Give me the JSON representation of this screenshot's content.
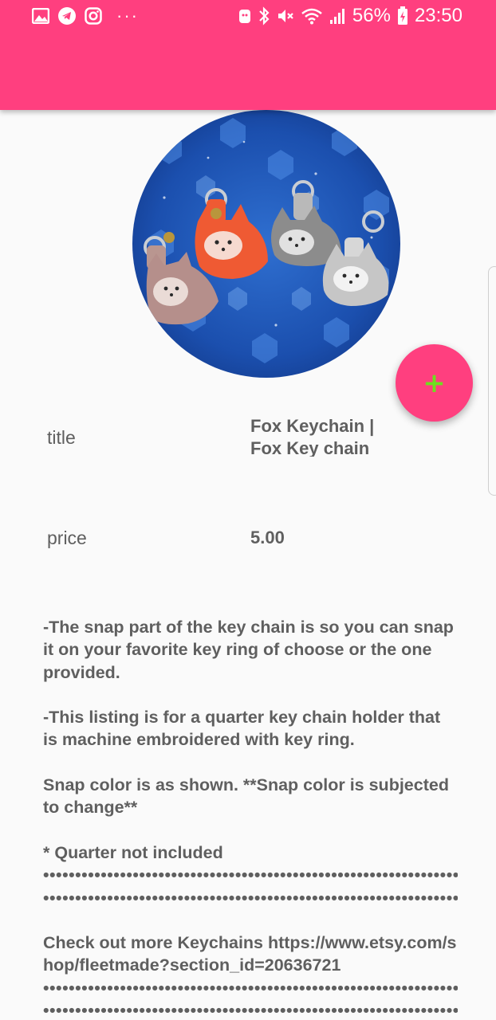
{
  "status_bar": {
    "icons_left": [
      "gallery-icon",
      "telegram-icon",
      "instagram-icon"
    ],
    "more": "···",
    "icons_right": [
      "alarm-icon",
      "bluetooth-icon",
      "mute-icon",
      "wifi-icon",
      "signal-icon"
    ],
    "battery": "56%",
    "time": "23:50"
  },
  "colors": {
    "accent": "#ff3f7f",
    "fab_icon": "#6ddf1f",
    "text": "#5f5f5f",
    "background": "#fafafa"
  },
  "product": {
    "image": "fox-keychains-photo",
    "fields": [
      {
        "label": "title",
        "value": "Fox Keychain | Fox Key chain"
      },
      {
        "label": "price",
        "value": "5.00"
      }
    ],
    "description": [
      "-The snap part of the key chain is so you can snap it on your favorite key ring of choose or the one provided.",
      "-This listing is for a quarter key chain holder that is machine embroidered with key ring.",
      "Snap color is as shown. **Snap color is subjected to  change**",
      "* Quarter not included",
      "Check out more Keychains  https://www.etsy.com/shop/fleetmade?section_id=20636721"
    ],
    "dots_line_1": "••••••••••••••••••••••••••••••••••••••••••••••••••••••••••••••••••••••••••••••",
    "dots_line_2": "••••••••••••••••••••••••••••••••••••••••••••••••••••••••••••••••••••"
  },
  "fab": {
    "icon": "plus-icon",
    "symbol": "+"
  }
}
